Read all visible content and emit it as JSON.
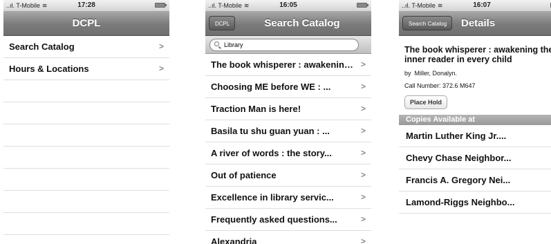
{
  "screens": [
    {
      "status": {
        "carrier": "T-Mobile",
        "time": "17:28"
      },
      "nav": {
        "title": "DCPL"
      },
      "rows": [
        "Search Catalog",
        "Hours & Locations"
      ]
    },
    {
      "status": {
        "carrier": "T-Mobile",
        "time": "16:05"
      },
      "nav": {
        "back": "DCPL",
        "title": "Search Catalog"
      },
      "search": {
        "value": "Library"
      },
      "rows": [
        "The book whisperer : awakening the inner reader",
        "Choosing ME before WE : ...",
        "Traction Man is here!",
        "Basila tu shu guan yuan : ...",
        "A river of words : the story...",
        "Out of patience",
        "Excellence in library servic...",
        "Frequently asked questions...",
        "Alexandria"
      ]
    },
    {
      "status": {
        "carrier": "T-Mobile",
        "time": "16:07"
      },
      "nav": {
        "back": "Search Catalog",
        "title": "Details"
      },
      "detail": {
        "title": "The book whisperer : awakening the inner reader in every child",
        "by_label": "by",
        "author": "Miller, Donalyn.",
        "call_number": "Call Number: 372.6 M647",
        "place_hold": "Place Hold",
        "copies_header": "Copies Available at"
      },
      "rows": [
        "Martin Luther King Jr....",
        "Chevy Chase Neighbor...",
        "Francis A. Gregory Nei...",
        "Lamond-Riggs Neighbo..."
      ]
    }
  ]
}
